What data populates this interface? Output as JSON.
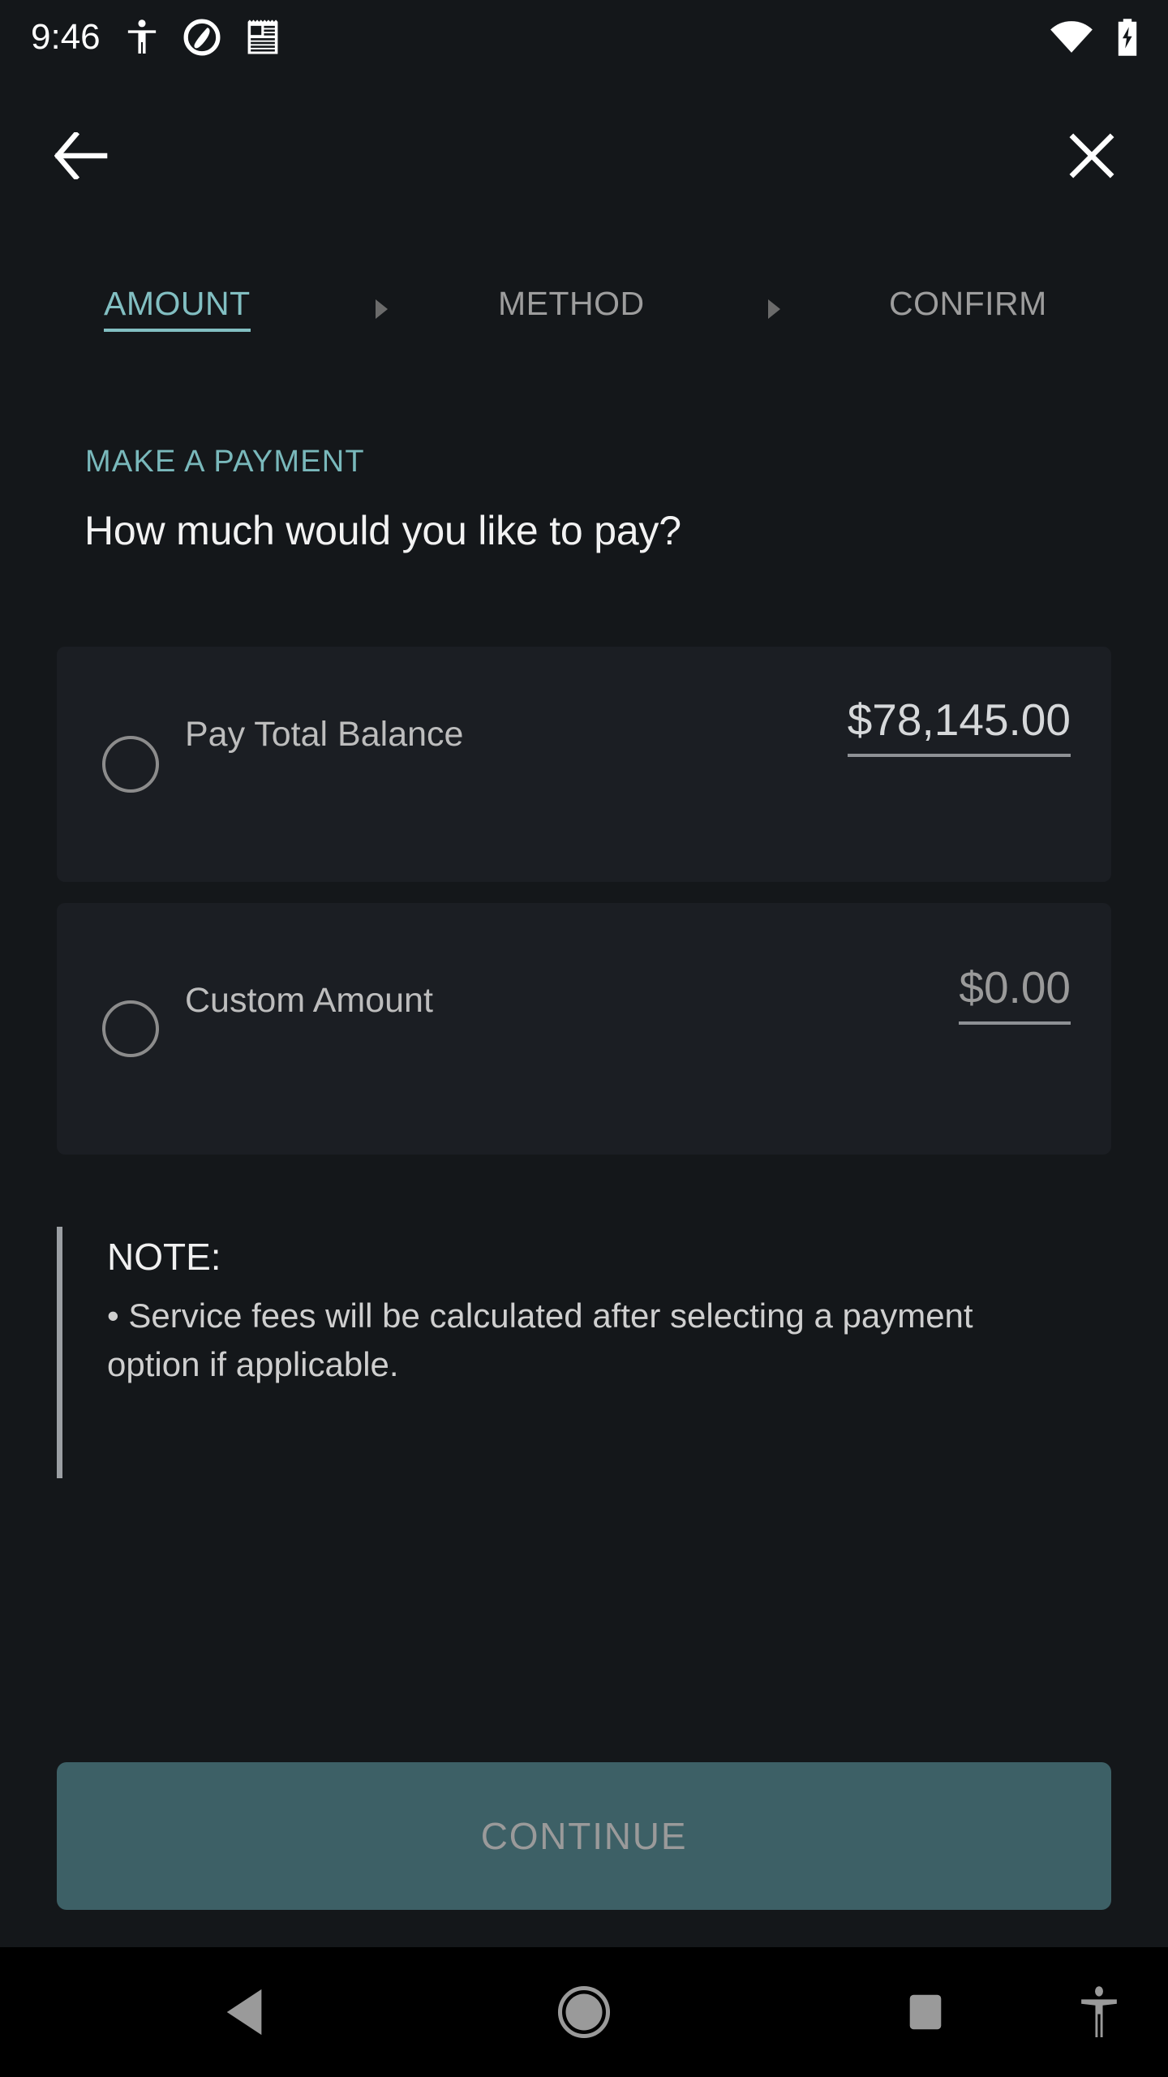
{
  "status_bar": {
    "time": "9:46",
    "left_icons": [
      "accessibility-icon",
      "do-not-disturb-icon",
      "news-document-icon"
    ],
    "right_icons": [
      "wifi-icon",
      "battery-charging-icon"
    ]
  },
  "app_bar": {
    "back_icon": "back-arrow-icon",
    "close_icon": "close-x-icon"
  },
  "stepper": {
    "steps": [
      {
        "label": "AMOUNT",
        "state": "active"
      },
      {
        "label": "METHOD",
        "state": "inactive"
      },
      {
        "label": "CONFIRM",
        "state": "inactive"
      }
    ],
    "separator_icon": "triangle-right-icon"
  },
  "main": {
    "eyebrow": "MAKE A PAYMENT",
    "headline": "How much would you like to pay?",
    "options": [
      {
        "label": "Pay Total Balance",
        "amount": "$78,145.00",
        "selected": false,
        "amount_style": "value"
      },
      {
        "label": "Custom Amount",
        "amount": "$0.00",
        "selected": false,
        "amount_style": "placeholder"
      }
    ],
    "note": {
      "title": "NOTE:",
      "body": "• Service fees will be calculated after selecting a payment option if applicable."
    }
  },
  "footer": {
    "continue_label": "CONTINUE",
    "continue_enabled": false
  },
  "nav_bar": {
    "back_icon": "nav-back-triangle-icon",
    "home_icon": "nav-home-circle-icon",
    "recents_icon": "nav-recents-square-icon",
    "accessibility_icon": "nav-accessibility-icon"
  },
  "colors": {
    "background": "#14171a",
    "card": "#1b1e23",
    "accent_teal": "#82bfc2",
    "eyebrow_teal": "#79b8bb",
    "button_fill": "#3d6066",
    "disabled_text": "#9a9a9a",
    "nav_bar": "#000000"
  }
}
